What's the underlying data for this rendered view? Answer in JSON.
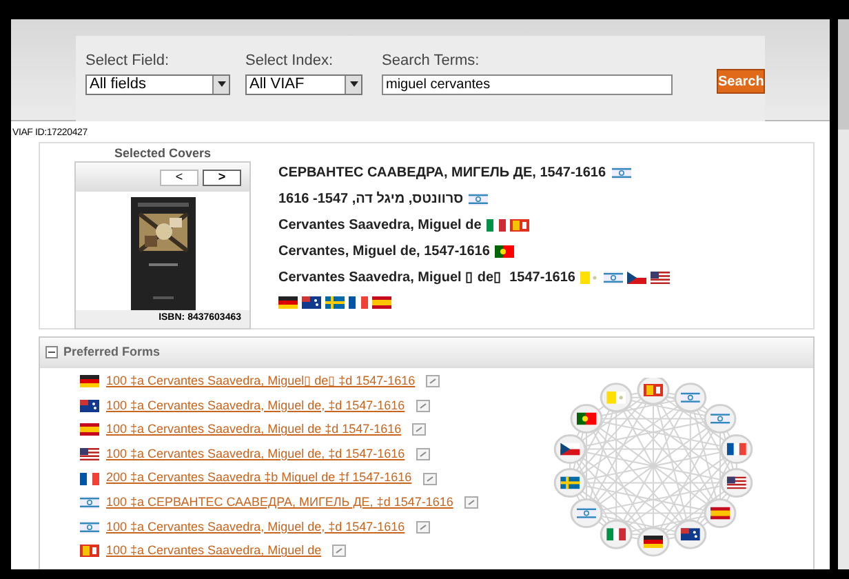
{
  "search": {
    "field_label": "Select Field:",
    "field_value": "All fields",
    "index_label": "Select Index:",
    "index_value": "All VIAF",
    "terms_label": "Search Terms:",
    "terms_value": "miguel cervantes",
    "button": "Search"
  },
  "viaf_id": "VIAF ID:17220427",
  "covers": {
    "title": "Selected Covers",
    "prev": "<",
    "next": ">",
    "isbn": "ISBN: 8437603463"
  },
  "names": [
    {
      "text": "СЕРВАНТЕС СААВЕДРА, МИГЕЛЬ ДЕ, 1547-1616",
      "flags": [
        {
          "kind": "israel"
        }
      ]
    },
    {
      "text": "סרוונטס, מיגל דה, 1547- 1616",
      "flags": [
        {
          "kind": "israel"
        }
      ]
    },
    {
      "text": "Cervantes Saavedra, Miguel de",
      "flags": [
        {
          "kind": "italy"
        },
        {
          "kind": "swiss"
        }
      ]
    },
    {
      "text": "Cervantes, Miguel de, 1547-1616",
      "flags": [
        {
          "kind": "portugal"
        }
      ]
    },
    {
      "text": "Cervantes Saavedra, Miguel ▯ de▯  1547-1616",
      "flags": [
        {
          "kind": "vatican"
        },
        {
          "kind": "israel"
        },
        {
          "kind": "czech"
        },
        {
          "kind": "usa"
        },
        {
          "kind": "germany"
        },
        {
          "kind": "australia"
        },
        {
          "kind": "sweden"
        },
        {
          "kind": "france"
        },
        {
          "kind": "spain"
        }
      ]
    }
  ],
  "preferred_forms": {
    "title": "Preferred Forms",
    "expanded": true,
    "rows": [
      {
        "kind": "germany",
        "text": "100 ‡a Cervantes Saavedra, Miguel▯ de▯ ‡d 1547-1616"
      },
      {
        "kind": "australia",
        "text": "100 ‡a Cervantes Saavedra, Miguel de, ‡d 1547-1616"
      },
      {
        "kind": "spain",
        "text": "100 ‡a Cervantes Saavedra, Miguel de ‡d 1547-1616"
      },
      {
        "kind": "usa",
        "text": "100 ‡a Cervantes Saavedra, Miguel de, ‡d 1547-1616"
      },
      {
        "kind": "france",
        "text": "200 ‡a Cervantes Saavedra ‡b Miguel de ‡f 1547-1616"
      },
      {
        "kind": "israel",
        "text": "100 ‡a СЕРВАНТЕС СААВЕДРА, МИГЕЛЬ ДЕ, ‡d 1547-1616"
      },
      {
        "kind": "israel",
        "text": "100 ‡a Cervantes Saavedra, Miguel de, ‡d 1547-1616"
      },
      {
        "kind": "swiss",
        "text": "100 ‡a Cervantes Saavedra, Miguel de"
      }
    ],
    "network": {
      "nodes": [
        {
          "kind": "swiss"
        },
        {
          "kind": "israel"
        },
        {
          "kind": "israel"
        },
        {
          "kind": "france"
        },
        {
          "kind": "usa"
        },
        {
          "kind": "spain"
        },
        {
          "kind": "australia"
        },
        {
          "kind": "germany"
        },
        {
          "kind": "italy"
        },
        {
          "kind": "israel"
        },
        {
          "kind": "sweden"
        },
        {
          "kind": "czech"
        },
        {
          "kind": "portugal"
        },
        {
          "kind": "vatican"
        }
      ]
    }
  }
}
